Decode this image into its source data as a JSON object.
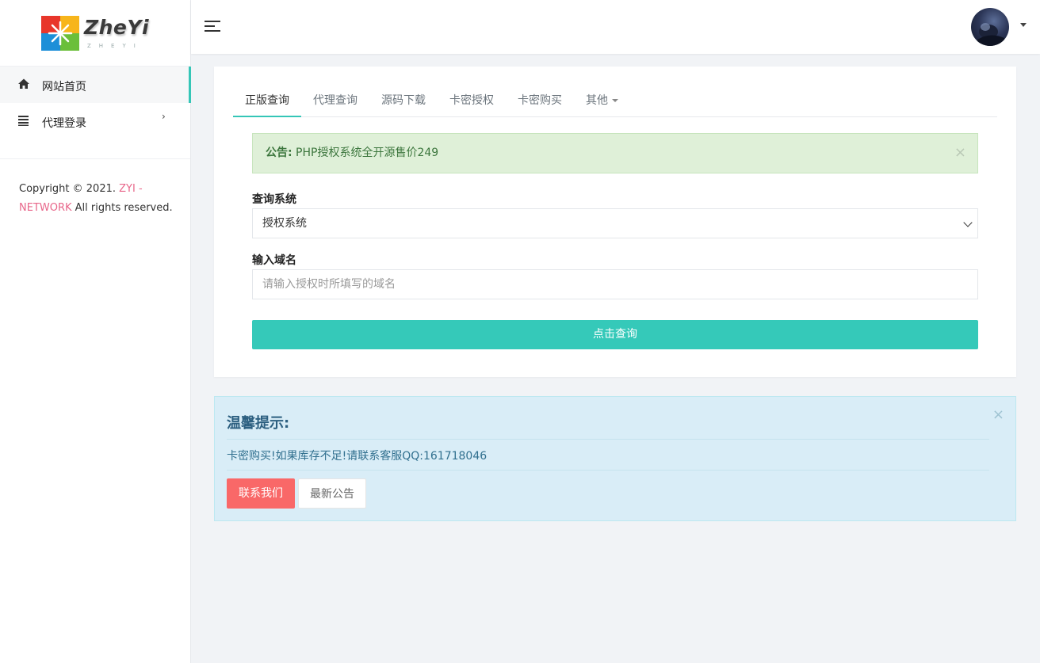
{
  "brand": {
    "name": "ZheYi",
    "subtitle": "ZHEYI"
  },
  "sidebar": {
    "items": [
      {
        "label": "网站首页",
        "icon": "home-icon",
        "active": true
      },
      {
        "label": "代理登录",
        "icon": "list-icon",
        "has_submenu": true
      }
    ],
    "copyright": {
      "prefix": "Copyright © 2021. ",
      "link": "ZYI - NETWORK",
      "suffix": " All rights reserved."
    }
  },
  "topbar": {
    "menu_icon": "hamburger-icon",
    "avatar_icon": "user-avatar"
  },
  "tabs": [
    {
      "label": "正版查询",
      "active": true
    },
    {
      "label": "代理查询"
    },
    {
      "label": "源码下载"
    },
    {
      "label": "卡密授权"
    },
    {
      "label": "卡密购买"
    },
    {
      "label": "其他",
      "dropdown": true
    }
  ],
  "notice": {
    "label": "公告:",
    "text": " PHP授权系统全开源售价249",
    "close": "×"
  },
  "form": {
    "system_label": "查询系统",
    "system_value": "授权系统",
    "domain_label": "输入域名",
    "domain_placeholder": "请输入授权时所填写的域名",
    "submit_label": "点击查询"
  },
  "tips": {
    "title": "温馨提示:",
    "close": "×",
    "text": "卡密购买!如果库存不足!请联系客服QQ:161718046",
    "contact_label": "联系我们",
    "news_label": "最新公告"
  },
  "colors": {
    "accent": "#35c9b9",
    "danger": "#f96868",
    "link_pink": "#e8668a",
    "success_bg": "#dff0d8",
    "info_bg": "#d9edf7"
  }
}
